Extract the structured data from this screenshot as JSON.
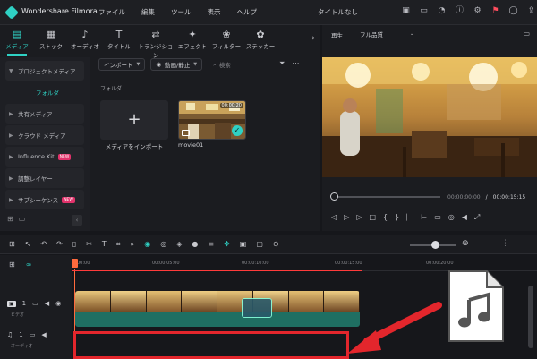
{
  "app": {
    "name": "Wondershare Filmora",
    "document_title": "タイトルなし"
  },
  "menu": [
    "ファイル",
    "編集",
    "ツール",
    "表示",
    "ヘルプ"
  ],
  "category_tabs": [
    {
      "label": "メディア",
      "icon": "media-icon",
      "active": true
    },
    {
      "label": "ストック",
      "icon": "stock-icon"
    },
    {
      "label": "オーディオ",
      "icon": "music-note-icon"
    },
    {
      "label": "タイトル",
      "icon": "title-text-icon"
    },
    {
      "label": "トランジション",
      "icon": "transition-icon"
    },
    {
      "label": "エフェクト",
      "icon": "effects-icon"
    },
    {
      "label": "フィルター",
      "icon": "filter-icon"
    },
    {
      "label": "ステッカー",
      "icon": "sticker-icon"
    }
  ],
  "sidebar": {
    "items": [
      {
        "label": "プロジェクトメディア",
        "open": true
      },
      {
        "label": "フォルダ",
        "sub": true
      },
      {
        "label": "共有メディア"
      },
      {
        "label": "クラウド メディア"
      },
      {
        "label": "Influence Kit",
        "badge": "NEW"
      },
      {
        "label": "調整レイヤー"
      },
      {
        "label": "サブシーケンス",
        "badge": "NEW"
      }
    ]
  },
  "media_toolbar": {
    "import_label": "インポート",
    "filter_label": "動画/静止",
    "search_placeholder": "検索"
  },
  "media_area": {
    "folder_label": "フォルダ",
    "import_tile_label": "メディアをインポート",
    "clip": {
      "name": "movie01",
      "duration": "00:00:20"
    }
  },
  "player": {
    "mode_label": "再生",
    "quality_label": "フル品質",
    "current_time": "00:00:00:00",
    "separator": "/",
    "total_time": "00:00:15:15"
  },
  "timeline": {
    "ruler_labels": [
      "00:00",
      "00:00:05:00",
      "00:00:10:00",
      "00:00:15:00",
      "00:00:20:00"
    ],
    "tracks": [
      {
        "icon": "video-track-icon",
        "index": "1",
        "name": "ビデオ"
      },
      {
        "icon": "audio-track-icon",
        "index": "1",
        "name": "オーディオ"
      }
    ]
  },
  "colors": {
    "accent": "#2fd1c4",
    "highlight": "#e3262c",
    "badge": "#e2326b"
  }
}
